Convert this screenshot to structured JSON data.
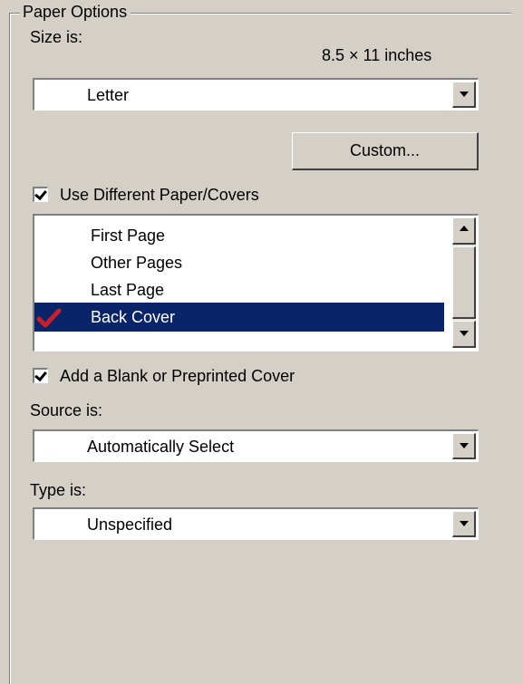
{
  "group": {
    "title": "Paper Options"
  },
  "size": {
    "label": "Size is:",
    "dimensions": "8.5 × 11 inches",
    "selected": "Letter"
  },
  "custom_button": {
    "label": "Custom..."
  },
  "different_paper": {
    "label": "Use Different Paper/Covers",
    "checked": true
  },
  "pages_list": {
    "items": [
      "First Page",
      "Other Pages",
      "Last Page",
      "Back Cover"
    ],
    "selected": "Back Cover",
    "marked_color": "#c8202a",
    "highlight_color": "#0a246a"
  },
  "cover": {
    "label": "Add a Blank or Preprinted Cover",
    "checked": true
  },
  "source": {
    "label": "Source is:",
    "selected": "Automatically Select"
  },
  "type": {
    "label": "Type is:",
    "selected": "Unspecified"
  }
}
